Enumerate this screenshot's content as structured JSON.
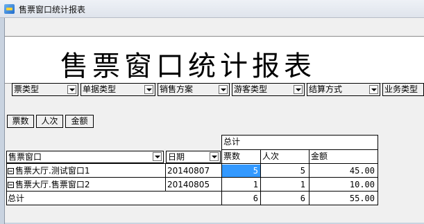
{
  "window": {
    "title": "售票窗口统计报表",
    "icon": "app-icon"
  },
  "report": {
    "title": "售票窗口统计报表"
  },
  "filters": [
    {
      "label": "票类型"
    },
    {
      "label": "单据类型"
    },
    {
      "label": "销售方案"
    },
    {
      "label": "游客类型"
    },
    {
      "label": "结算方式"
    },
    {
      "label": "业务类型"
    }
  ],
  "data_fields": [
    "票数",
    "人次",
    "金额"
  ],
  "table": {
    "row_field": "售票窗口",
    "date_field": "日期",
    "total_header": "总计",
    "columns": [
      "票数",
      "人次",
      "金额"
    ],
    "rows": [
      {
        "window": "售票大厅.测试窗口1",
        "date": "20140807",
        "tickets": "5",
        "people": "5",
        "amount": "45.00",
        "selected_col": "tickets"
      },
      {
        "window": "售票大厅.售票窗口2",
        "date": "20140805",
        "tickets": "1",
        "people": "1",
        "amount": "10.00"
      }
    ],
    "total_row": {
      "label": "总计",
      "tickets": "6",
      "people": "6",
      "amount": "55.00"
    }
  },
  "colors": {
    "selection": "#3399ff",
    "background": "#f0f0f0"
  }
}
